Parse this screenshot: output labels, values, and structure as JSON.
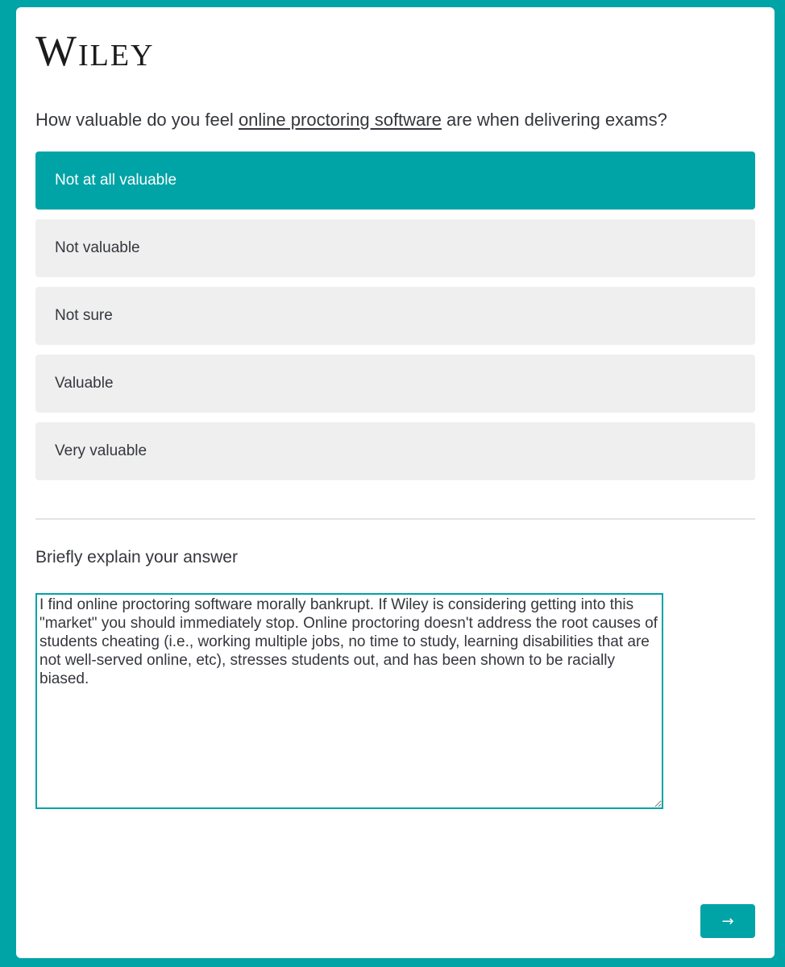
{
  "brand": {
    "logo_text": "Wiley"
  },
  "question": {
    "prefix": "How valuable do you feel ",
    "link_text": "online proctoring software",
    "suffix": " are when delivering exams?"
  },
  "options": [
    {
      "label": "Not at all valuable",
      "selected": true
    },
    {
      "label": "Not valuable",
      "selected": false
    },
    {
      "label": "Not sure",
      "selected": false
    },
    {
      "label": "Valuable",
      "selected": false
    },
    {
      "label": "Very valuable",
      "selected": false
    }
  ],
  "explanation": {
    "label": "Briefly explain your answer",
    "value": "I find online proctoring software morally bankrupt. If Wiley is considering getting into this \"market\" you should immediately stop. Online proctoring doesn't address the root causes of students cheating (i.e., working multiple jobs, no time to study, learning disabilities that are not well-served online, etc), stresses students out, and has been shown to be racially biased."
  },
  "navigation": {
    "next_icon": "arrow-right-icon",
    "next_glyph": "→"
  },
  "colors": {
    "accent": "#00a3a6",
    "option_background": "#efefef",
    "text": "#35373d"
  }
}
